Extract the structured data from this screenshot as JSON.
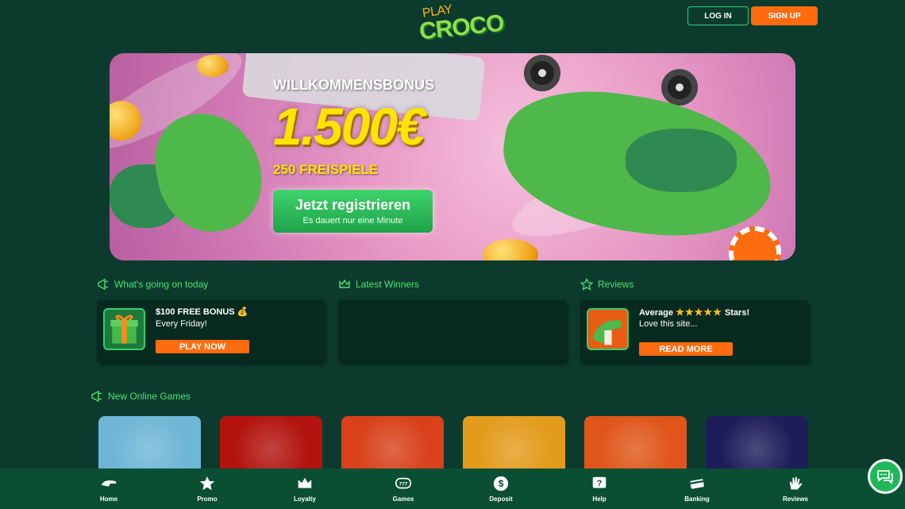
{
  "header": {
    "logo_top": "PLAY",
    "logo_bottom": "CROCO",
    "login_label": "LOG IN",
    "signup_label": "SIGN UP"
  },
  "banner": {
    "title": "WILLKOMMENSBONUS",
    "amount": "1.500€",
    "spins": "250 FREISPIELE",
    "cta_label": "Jetzt registrieren",
    "cta_sub": "Es dauert nur eine Minute"
  },
  "sections": {
    "today": {
      "heading": "What's going on today",
      "card_title": "$100 FREE BONUS 💰",
      "card_sub": "Every Friday!",
      "button": "PLAY NOW"
    },
    "winners": {
      "heading": "Latest Winners"
    },
    "reviews": {
      "heading": "Reviews",
      "title_prefix": "Average",
      "stars": "★★★★★",
      "title_suffix": "Stars!",
      "sub": "Love this site...",
      "button": "READ MORE"
    },
    "new_games": {
      "heading": "New Online Games"
    }
  },
  "games": [
    {
      "name": "game-tile-fish",
      "bg": "#6fb6d6"
    },
    {
      "name": "game-tile-devil",
      "bg": "#b3140f"
    },
    {
      "name": "game-tile-dino",
      "bg": "#d8411a"
    },
    {
      "name": "game-tile-dragon",
      "bg": "#e39b1c"
    },
    {
      "name": "game-tile-fire",
      "bg": "#e0561a"
    },
    {
      "name": "game-tile-wheel",
      "bg": "#1d1d5a"
    }
  ],
  "nav": [
    {
      "label": "Home",
      "icon": "croc-icon"
    },
    {
      "label": "Promo",
      "icon": "star-icon"
    },
    {
      "label": "Loyalty",
      "icon": "crown-icon"
    },
    {
      "label": "Games",
      "icon": "slot-icon"
    },
    {
      "label": "Deposit",
      "icon": "dollar-icon"
    },
    {
      "label": "Help",
      "icon": "help-icon"
    },
    {
      "label": "Banking",
      "icon": "card-icon"
    },
    {
      "label": "Reviews",
      "icon": "hand-icon"
    }
  ],
  "colors": {
    "background": "#0c3b2e",
    "accent_green": "#2fd06f",
    "accent_orange": "#ff6b0f",
    "bonus_yellow": "#ffe400"
  }
}
